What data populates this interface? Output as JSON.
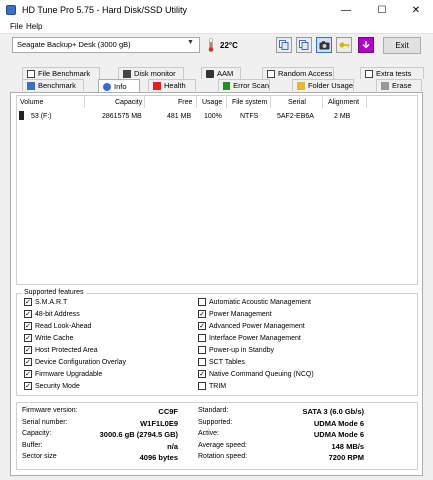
{
  "window": {
    "title": "HD Tune Pro 5.75 - Hard Disk/SSD Utility",
    "minimize": "—",
    "maximize": "☐",
    "close": "✕"
  },
  "menu": [
    "File",
    "Help"
  ],
  "toolbar": {
    "drive": "Seagate Backup+ Desk (3000 gB)",
    "temperature": "22°C",
    "exit_label": "Exit",
    "icons": [
      "copy-icon",
      "copy-icon",
      "camera-icon",
      "key-icon",
      "download-icon"
    ]
  },
  "tabs_top": [
    "File Benchmark",
    "Disk monitor",
    "AAM",
    "Random Access",
    "Extra tests"
  ],
  "tabs_bottom": [
    "Benchmark",
    "Info",
    "Health",
    "Error Scan",
    "Folder Usage",
    "Erase"
  ],
  "selected_tab": "Info",
  "volume_table": {
    "headers": [
      "Volume",
      "Capacity",
      "Free",
      "Usage",
      "File system",
      "Serial",
      "Alignment"
    ],
    "rows": [
      [
        "53 (F:)",
        "2861575 MB",
        "481 MB",
        "100%",
        "NTFS",
        "5AF2-EB6A",
        "2 MB"
      ]
    ]
  },
  "features": {
    "legend": "Supported features",
    "left": [
      {
        "label": "S.M.A.R.T",
        "checked": true
      },
      {
        "label": "48-bit Address",
        "checked": true
      },
      {
        "label": "Read Look-Ahead",
        "checked": true
      },
      {
        "label": "Write Cache",
        "checked": true
      },
      {
        "label": "Host Protected Area",
        "checked": true
      },
      {
        "label": "Device Configuration Overlay",
        "checked": true
      },
      {
        "label": "Firmware Upgradable",
        "checked": true
      },
      {
        "label": "Security Mode",
        "checked": true
      }
    ],
    "right": [
      {
        "label": "Automatic Acoustic Management",
        "checked": false
      },
      {
        "label": "Power Management",
        "checked": true
      },
      {
        "label": "Advanced Power Management",
        "checked": true
      },
      {
        "label": "Interface Power Management",
        "checked": false
      },
      {
        "label": "Power-up in Standby",
        "checked": false
      },
      {
        "label": "SCT Tables",
        "checked": false
      },
      {
        "label": "Native Command Queuing (NCQ)",
        "checked": true
      },
      {
        "label": "TRIM",
        "checked": false
      }
    ]
  },
  "info": {
    "left": [
      {
        "label": "Firmware version:",
        "value": "CC9F"
      },
      {
        "label": "Serial number:",
        "value": "W1F1L0E9"
      },
      {
        "label": "Capacity:",
        "value": "3000.6 gB (2794.5 GB)"
      },
      {
        "label": "Buffer:",
        "value": "n/a"
      },
      {
        "label": "Sector size",
        "value": "4096 bytes"
      }
    ],
    "right": [
      {
        "label": "Standard:",
        "value": "SATA 3 (6.0 Gb/s)"
      },
      {
        "label": "Supported:",
        "value": "UDMA Mode 6"
      },
      {
        "label": "Active:",
        "value": "UDMA Mode 6"
      },
      {
        "label": "Average speed:",
        "value": "148 MB/s"
      },
      {
        "label": "Rotation speed:",
        "value": "7200 RPM"
      }
    ]
  },
  "colors": {
    "thermometer": "#c0392b",
    "key": "#d4b800",
    "download": "#b000c8"
  }
}
